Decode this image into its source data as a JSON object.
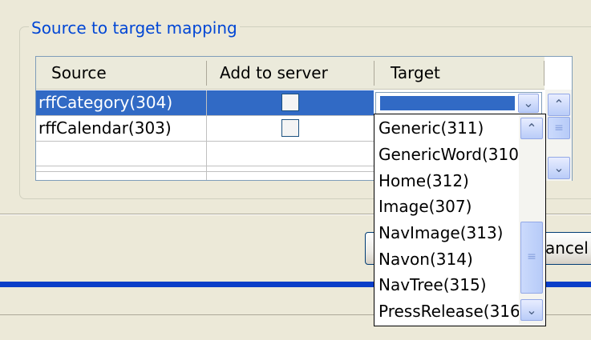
{
  "group": {
    "title": "Source to target mapping"
  },
  "grid": {
    "columns": [
      "Source",
      "Add to server",
      "Target"
    ],
    "rows": [
      {
        "source": "rffCategory(304)",
        "add_to_server": false,
        "target": "",
        "selected": true
      },
      {
        "source": "rffCalendar(303)",
        "add_to_server": false,
        "target": ""
      }
    ]
  },
  "dropdown": {
    "items": [
      "Generic(311)",
      "GenericWord(310",
      "Home(312)",
      "Image(307)",
      "NavImage(313)",
      "Navon(314)",
      "NavTree(315)",
      "PressRelease(316"
    ]
  },
  "buttons": {
    "cancel_label": "ancel"
  },
  "icons": {
    "dropdown_arrow": "chevron-down-icon",
    "scroll_up": "chevron-up-icon",
    "scroll_down": "chevron-down-icon",
    "thumb_grip": "grip-icon"
  },
  "colors": {
    "selection": "#316ac5",
    "group_title": "#0046d5",
    "bottom_bar": "#0a3ec8",
    "window_bg": "#ece9d8"
  }
}
